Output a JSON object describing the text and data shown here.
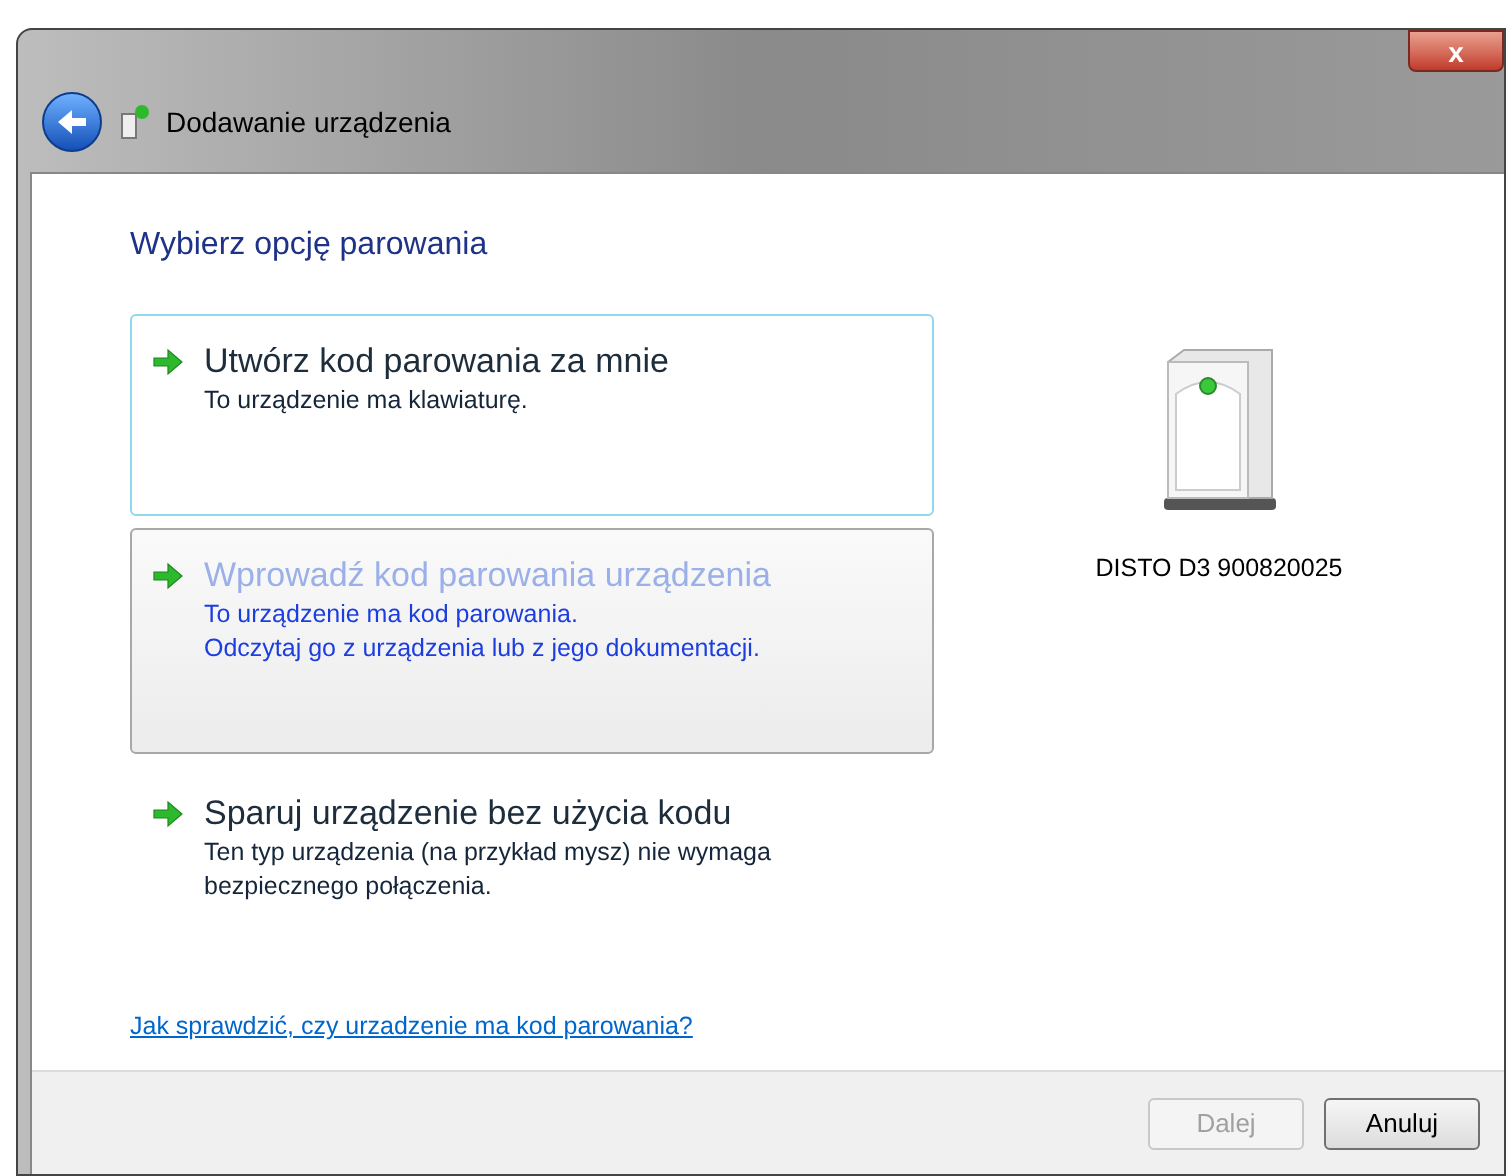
{
  "window": {
    "title": "Dodawanie urządzenia",
    "close_label": "x"
  },
  "heading": "Wybierz opcję parowania",
  "options": [
    {
      "title": "Utwórz kod parowania za mnie",
      "description": [
        "To urządzenie ma klawiaturę."
      ],
      "kind": "focused"
    },
    {
      "title": "Wprowadź kod parowania urządzenia",
      "description": [
        "To urządzenie ma kod parowania.",
        "Odczytaj go z urządzenia lub z jego dokumentacji."
      ],
      "kind": "hovered"
    },
    {
      "title": "Sparuj urządzenie bez użycia kodu",
      "description": [
        "Ten typ urządzenia (na przykład mysz) nie wymaga",
        "bezpiecznego połączenia."
      ],
      "kind": "normal"
    }
  ],
  "device": {
    "name": "DISTO D3 900820025"
  },
  "help_link": "Jak sprawdzić, czy urzadzenie ma kod parowania?",
  "buttons": [
    {
      "label": "Dalej",
      "disabled": true
    },
    {
      "label": "Anuluj",
      "disabled": false
    }
  ]
}
